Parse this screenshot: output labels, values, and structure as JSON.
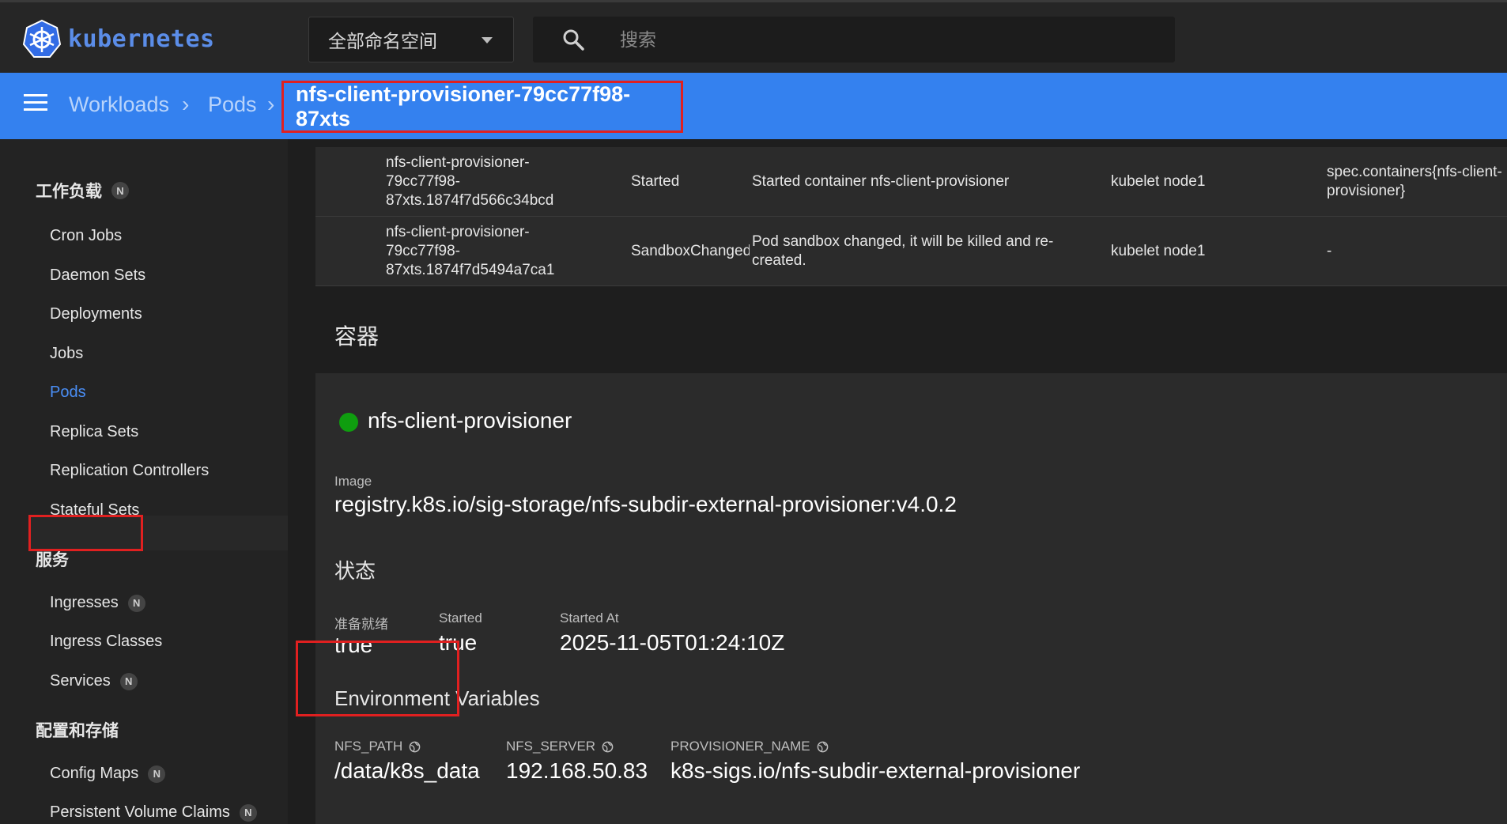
{
  "topbar": {
    "logo_text": "kubernetes",
    "namespace_select": "全部命名空间",
    "search_placeholder": "搜索"
  },
  "breadcrumb": {
    "items": [
      "Workloads",
      "Pods"
    ],
    "current": "nfs-client-provisioner-79cc77f98-87xts"
  },
  "sidebar": {
    "sections": [
      {
        "title": "工作负载",
        "badge": "N",
        "items": [
          {
            "label": "Cron Jobs"
          },
          {
            "label": "Daemon Sets"
          },
          {
            "label": "Deployments"
          },
          {
            "label": "Jobs"
          },
          {
            "label": "Pods",
            "active": true
          },
          {
            "label": "Replica Sets"
          },
          {
            "label": "Replication Controllers"
          },
          {
            "label": "Stateful Sets"
          }
        ]
      },
      {
        "title": "服务",
        "items": [
          {
            "label": "Ingresses",
            "badge": "N"
          },
          {
            "label": "Ingress Classes"
          },
          {
            "label": "Services",
            "badge": "N"
          }
        ]
      },
      {
        "title": "配置和存储",
        "items": [
          {
            "label": "Config Maps",
            "badge": "N"
          },
          {
            "label": "Persistent Volume Claims",
            "badge": "N"
          }
        ]
      }
    ]
  },
  "events": [
    {
      "name": "nfs-client-provisioner-\n79cc77f98-\n87xts.1874f7d566c34bcd",
      "reason": "Started",
      "message": "Started container nfs-client-provisioner",
      "source": "kubelet node1",
      "object": "spec.containers{nfs-client-\nprovisioner}"
    },
    {
      "name": "nfs-client-provisioner-\n79cc77f98-\n87xts.1874f7d5494a7ca1",
      "reason": "SandboxChanged",
      "message": "Pod sandbox changed, it will be killed and re-\ncreated.",
      "source": "kubelet node1",
      "object": "-"
    }
  ],
  "containers_title": "容器",
  "container": {
    "name": "nfs-client-provisioner",
    "status_color": "#0f9d0f",
    "image_label": "Image",
    "image": "registry.k8s.io/sig-storage/nfs-subdir-external-provisioner:v4.0.2",
    "status_title": "状态",
    "status": [
      {
        "label": "准备就绪",
        "value": "true"
      },
      {
        "label": "Started",
        "value": "true"
      },
      {
        "label": "Started At",
        "value": "2025-11-05T01:24:10Z"
      }
    ],
    "env_title": "Environment Variables",
    "env": [
      {
        "name": "NFS_PATH",
        "value": "/data/k8s_data"
      },
      {
        "name": "NFS_SERVER",
        "value": "192.168.50.83"
      },
      {
        "name": "PROVISIONER_NAME",
        "value": "k8s-sigs.io/nfs-subdir-external-provisioner"
      }
    ]
  },
  "colors": {
    "accent": "#3481ef",
    "highlight_box": "#e02020",
    "active_link": "#4a8ef5"
  }
}
